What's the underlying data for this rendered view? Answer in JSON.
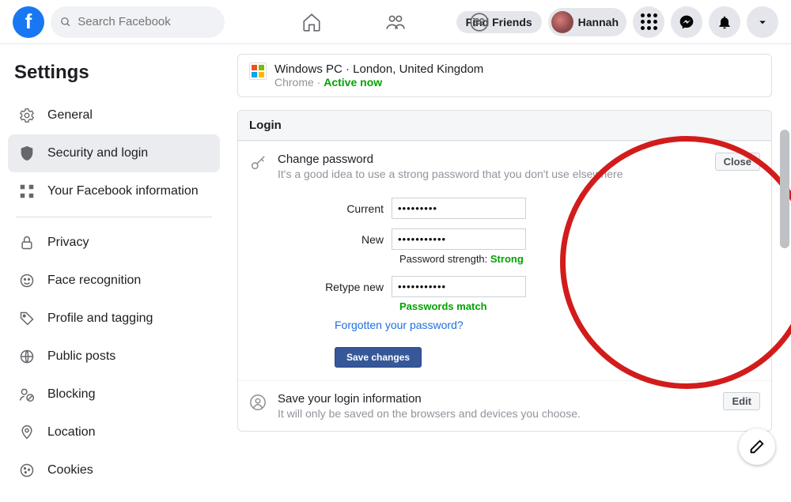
{
  "header": {
    "search_placeholder": "Search Facebook",
    "find_friends": "Find Friends",
    "username": "Hannah"
  },
  "sidebar": {
    "title": "Settings",
    "items_a": [
      {
        "label": "General"
      },
      {
        "label": "Security and login"
      },
      {
        "label": "Your Facebook information"
      }
    ],
    "items_b": [
      {
        "label": "Privacy"
      },
      {
        "label": "Face recognition"
      },
      {
        "label": "Profile and tagging"
      },
      {
        "label": "Public posts"
      },
      {
        "label": "Blocking"
      },
      {
        "label": "Location"
      },
      {
        "label": "Cookies"
      }
    ]
  },
  "session": {
    "title": "Windows PC · London, United Kingdom",
    "browser": "Chrome · ",
    "status": "Active now"
  },
  "login_section": {
    "header": "Login",
    "change_pw": {
      "title": "Change password",
      "subtitle": "It's a good idea to use a strong password that you don't use elsewhere",
      "close": "Close",
      "labels": {
        "current": "Current",
        "new": "New",
        "retype": "Retype new"
      },
      "values": {
        "current": "•••••••••",
        "new": "•••••••••••",
        "retype": "•••••••••••"
      },
      "strength_prefix": "Password strength: ",
      "strength_value": "Strong",
      "match_text": "Passwords match",
      "forgot": "Forgotten your password?",
      "save": "Save changes"
    },
    "save_login": {
      "title": "Save your login information",
      "subtitle": "It will only be saved on the browsers and devices you choose.",
      "edit": "Edit"
    }
  }
}
